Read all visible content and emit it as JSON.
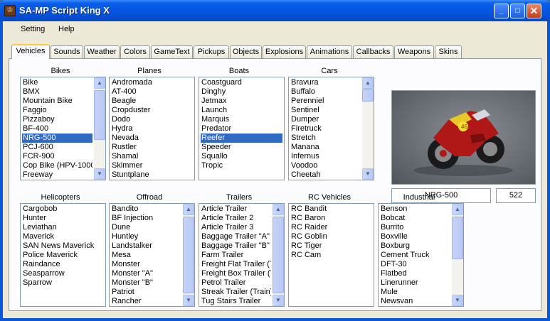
{
  "window": {
    "title": "SA-MP Script King X"
  },
  "menu": [
    "Setting",
    "Help"
  ],
  "tabs": [
    "Vehicles",
    "Sounds",
    "Weather",
    "Colors",
    "GameText",
    "Pickups",
    "Objects",
    "Explosions",
    "Animations",
    "Callbacks",
    "Weapons",
    "Skins"
  ],
  "active_tab": "Vehicles",
  "groups": {
    "bikes": {
      "label": "Bikes",
      "items": [
        "Bike",
        "BMX",
        "Mountain Bike",
        "Faggio",
        "Pizzaboy",
        "BF-400",
        "NRG-500",
        "PCJ-600",
        "FCR-900",
        "Cop Bike (HPV-1000",
        "Freeway"
      ],
      "selected": "NRG-500"
    },
    "planes": {
      "label": "Planes",
      "items": [
        "Andromada",
        "AT-400",
        "Beagle",
        "Cropduster",
        "Dodo",
        "Hydra",
        "Nevada",
        "Rustler",
        "Shamal",
        "Skimmer",
        "Stuntplane"
      ]
    },
    "boats": {
      "label": "Boats",
      "items": [
        "Coastguard",
        "Dinghy",
        "Jetmax",
        "Launch",
        "Marquis",
        "Predator",
        "Reefer",
        "Speeder",
        "Squallo",
        "Tropic"
      ],
      "selected": "Reefer"
    },
    "cars": {
      "label": "Cars",
      "items": [
        "Bravura",
        "Buffalo",
        "Perenniel",
        "Sentinel",
        "Dumper",
        "Firetruck",
        "Stretch",
        "Manana",
        "Infernus",
        "Voodoo",
        "Cheetah"
      ]
    },
    "helicopters": {
      "label": "Helicopters",
      "items": [
        "Cargobob",
        "Hunter",
        "Leviathan",
        "Maverick",
        "SAN News Maverick",
        "Police Maverick",
        "Raindance",
        "Seasparrow",
        "Sparrow"
      ]
    },
    "offroad": {
      "label": "Offroad",
      "items": [
        "Bandito",
        "BF Injection",
        "Dune",
        "Huntley",
        "Landstalker",
        "Mesa",
        "Monster",
        "Monster \"A\"",
        "Monster \"B\"",
        "Patriot",
        "Rancher"
      ]
    },
    "trailers": {
      "label": "Trailers",
      "items": [
        "Article Trailer",
        "Article Trailer 2",
        "Article Trailer 3",
        "Baggage Trailer \"A\"",
        "Baggage Trailer \"B\"",
        "Farm Trailer",
        "Freight Flat Trailer (T",
        "Freight Box Trailer (T",
        "Petrol Trailer",
        "Streak Trailer (Train)",
        "Tug Stairs Trailer"
      ]
    },
    "rc": {
      "label": "RC Vehicles",
      "items": [
        "RC Bandit",
        "RC Baron",
        "RC Raider",
        "RC Goblin",
        "RC Tiger",
        "RC Cam"
      ]
    },
    "industrial": {
      "label": "Industrial",
      "items": [
        "Benson",
        "Bobcat",
        "Burrito",
        "Boxville",
        "Boxburg",
        "Cement Truck",
        "DFT-30",
        "Flatbed",
        "Linerunner",
        "Mule",
        "Newsvan"
      ]
    }
  },
  "preview": {
    "name": "NRG-500",
    "id": "522"
  },
  "colors": {
    "selection": "#316ac5",
    "titlebar": "#0553de",
    "bike_red": "#b01818"
  }
}
